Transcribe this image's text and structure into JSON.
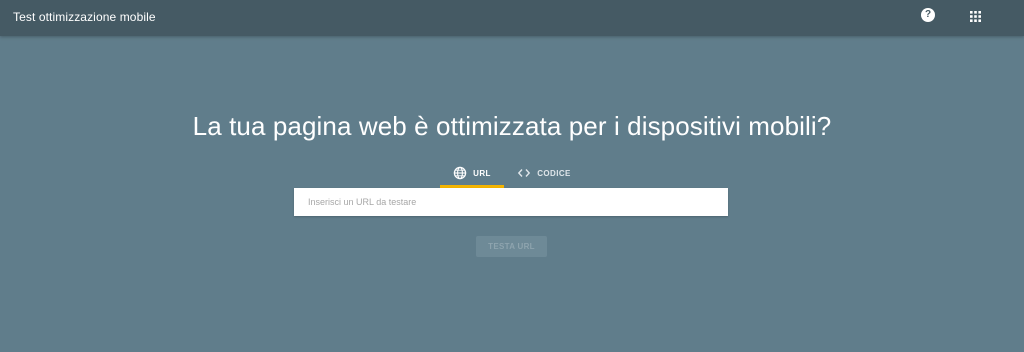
{
  "header": {
    "title": "Test ottimizzazione mobile",
    "help_icon": "help-icon",
    "help_glyph": "?",
    "apps_icon": "apps-grid-icon"
  },
  "main": {
    "headline": "La tua pagina web è ottimizzata per i dispositivi mobili?",
    "tabs": [
      {
        "label": "URL",
        "icon": "globe-icon",
        "selected": true
      },
      {
        "label": "CODICE",
        "icon": "code-icon",
        "selected": false
      }
    ],
    "url_input": {
      "placeholder": "Inserisci un URL da testare",
      "value": ""
    },
    "test_button": "TESTA URL"
  },
  "colors": {
    "background": "#607d8b",
    "topbar": "#455a64",
    "tab_indicator": "#f4b400",
    "input_bg": "#ffffff"
  }
}
